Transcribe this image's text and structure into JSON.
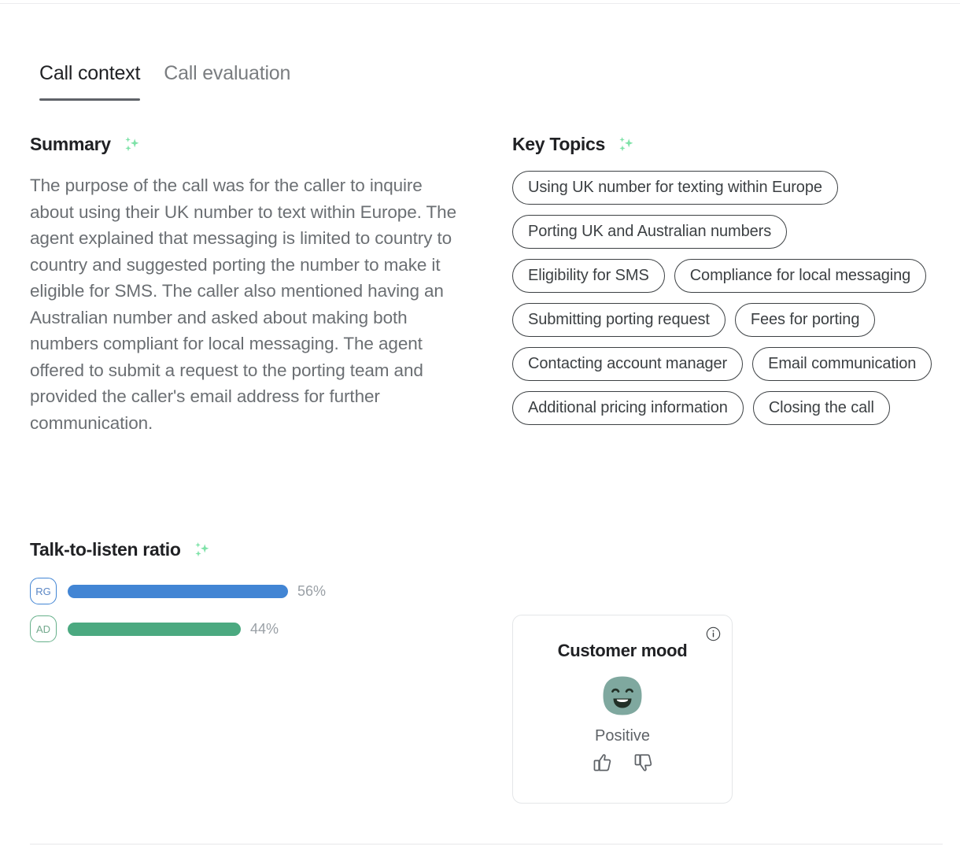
{
  "tabs": [
    {
      "label": "Call context",
      "active": true
    },
    {
      "label": "Call evaluation",
      "active": false
    }
  ],
  "summary": {
    "title": "Summary",
    "icon": "sparkle-icon",
    "text": "The purpose of the call was for the caller to inquire about using their UK number to text within Europe. The agent explained that messaging is limited to country to country and suggested porting the number to make it eligible for SMS. The caller also mentioned having an Australian number and asked about making both numbers compliant for local messaging. The agent offered to submit a request to the porting team and provided the caller's email address for further communication."
  },
  "talk_to_listen": {
    "title": "Talk-to-listen ratio",
    "icon": "sparkle-icon",
    "rows": [
      {
        "initials": "RG",
        "value": 56,
        "value_label": "56%",
        "color": "#4285d4"
      },
      {
        "initials": "AD",
        "value": 44,
        "value_label": "44%",
        "color": "#4ba980"
      }
    ]
  },
  "key_topics": {
    "title": "Key Topics",
    "icon": "sparkle-icon",
    "chips": [
      "Using UK number for texting within Europe",
      "Porting UK and Australian numbers",
      "Eligibility for SMS",
      "Compliance for local messaging",
      "Submitting porting request",
      "Fees for porting",
      "Contacting account manager",
      "Email communication",
      "Additional pricing information",
      "Closing the call"
    ]
  },
  "customer_mood": {
    "title": "Customer mood",
    "info_icon": "info-icon",
    "face_icon": "smiling-face-icon",
    "face_color": "#7fa89f",
    "label": "Positive",
    "thumbs_up": "thumbs-up-icon",
    "thumbs_down": "thumbs-down-icon"
  },
  "theme": {
    "accent_sparkle": "#7ee2a8",
    "text_primary": "#202124",
    "text_secondary": "#6b6f73",
    "muted": "#9aa0a6"
  }
}
